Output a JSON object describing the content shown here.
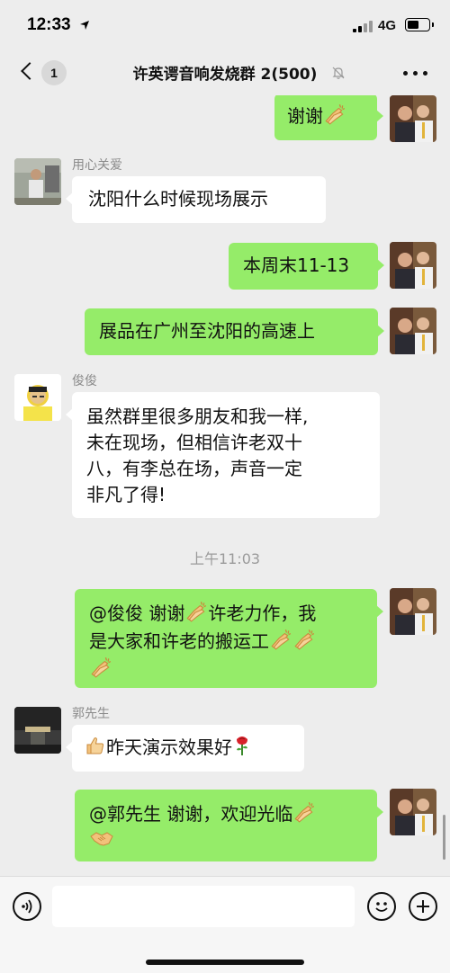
{
  "status_bar": {
    "time": "12:33",
    "network": "4G"
  },
  "nav": {
    "unread_count": "1",
    "title": "许英谔音响发烧群 2(500)"
  },
  "messages": [
    {
      "from": "me",
      "text": "谢谢"
    },
    {
      "from": "other",
      "sender": "用心关爱",
      "text": "沈阳什么时候现场展示"
    },
    {
      "from": "me",
      "text": "本周末11-13"
    },
    {
      "from": "me",
      "text": "展品在广州至沈阳的高速上"
    },
    {
      "from": "other",
      "sender": "俊俊",
      "lines": [
        "虽然群里很多朋友和我一样,",
        "未在现场，但相信许老双十",
        "八，有李总在场，声音一定",
        "非凡了得!"
      ]
    },
    {
      "time": "上午11:03"
    },
    {
      "from": "me",
      "lines": [
        "@俊俊 谢谢",
        "许老力作，我",
        "是大家和许老的搬运工"
      ]
    },
    {
      "from": "other",
      "sender": "郭先生",
      "text": "昨天演示效果好"
    },
    {
      "from": "me",
      "text": "@郭先生 谢谢，欢迎光临"
    }
  ],
  "input": {
    "placeholder": ""
  },
  "icons": {
    "back": "chevron-left-icon",
    "mute": "bell-slash-icon",
    "more": "more-dots-icon",
    "voice": "voice-icon",
    "emoji": "smiley-icon",
    "plus": "plus-icon",
    "clap": "clap-emoji",
    "thumbs_up": "thumbs-up-emoji",
    "rose": "rose-emoji",
    "handshake": "handshake-emoji"
  },
  "colors": {
    "background": "#ededed",
    "bubble_self": "#95ec69",
    "bubble_other": "#ffffff",
    "secondary_text": "#8a8a8a"
  }
}
